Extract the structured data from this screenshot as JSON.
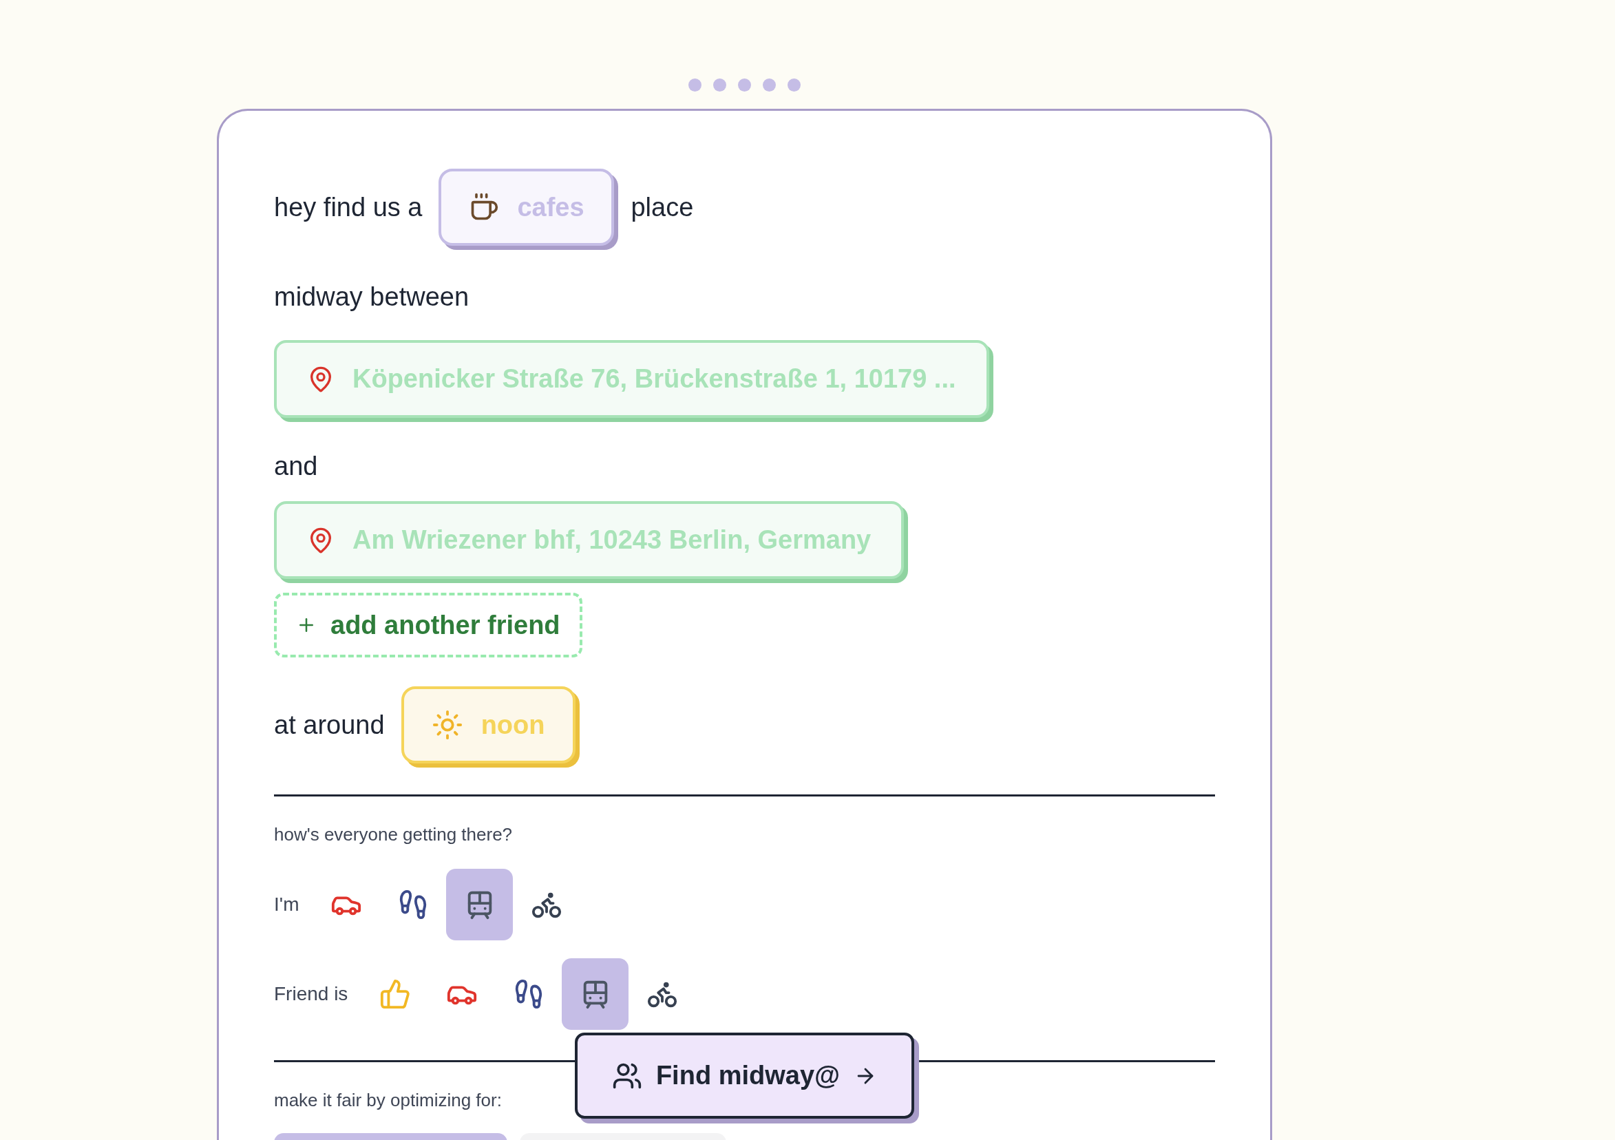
{
  "step_dots": [
    {
      "selected": false
    },
    {
      "selected": false
    },
    {
      "selected": false
    },
    {
      "selected": false
    },
    {
      "selected": false
    }
  ],
  "intro": {
    "before": "hey find us a",
    "category": "cafes",
    "after": "place"
  },
  "between_label": "midway between",
  "locations": [
    {
      "value": "Köpenicker Straße 76, Brückenstraße 1, 10179 ..."
    },
    {
      "value": "Am Wriezener bhf, 10243 Berlin, Germany"
    }
  ],
  "and_label": "and",
  "add_friend": "add another friend",
  "time": {
    "label": "at around",
    "value": "noon"
  },
  "transport": {
    "question": "how's everyone getting there?",
    "rows": [
      {
        "label": "I'm",
        "modes": [
          {
            "kind": "car",
            "selected": false
          },
          {
            "kind": "walk",
            "selected": false
          },
          {
            "kind": "tram",
            "selected": true
          },
          {
            "kind": "bike",
            "selected": false
          }
        ]
      },
      {
        "label": "Friend is",
        "modes": [
          {
            "kind": "thumbs-up",
            "selected": false
          },
          {
            "kind": "car",
            "selected": false
          },
          {
            "kind": "walk",
            "selected": false
          },
          {
            "kind": "tram",
            "selected": true
          },
          {
            "kind": "bike",
            "selected": false
          }
        ]
      }
    ]
  },
  "optimize": {
    "label": "make it fair by optimizing for:",
    "options": [
      {
        "selected": true
      },
      {
        "selected": false
      }
    ]
  },
  "find_button": "Find midway@"
}
